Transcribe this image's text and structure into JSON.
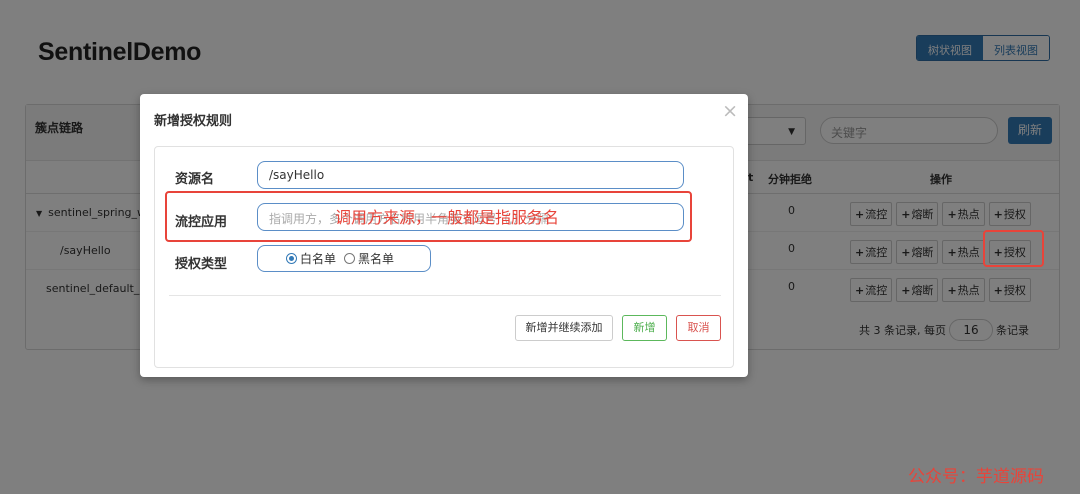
{
  "app": {
    "title": "SentinelDemo",
    "view_toggle": {
      "tree": "树状视图",
      "list": "列表视图"
    }
  },
  "panel": {
    "title": "簇点链路",
    "search_placeholder": "关键字",
    "refresh_label": "刷新",
    "columns": {
      "block_partial": "t",
      "minute_block": "分钟拒绝",
      "operations": "操作"
    },
    "rows": [
      {
        "name": "sentinel_spring_we",
        "expand_icon": "▼",
        "minute_block": "0"
      },
      {
        "name": "/sayHello",
        "minute_block": "0"
      },
      {
        "name": "sentinel_default_co",
        "minute_block": "0"
      }
    ],
    "op_labels": {
      "flow": "流控",
      "degrade": "熔断",
      "hotspot": "热点",
      "authority": "授权"
    },
    "pager": {
      "total_text": "共 3 条记录, 每页",
      "page_size": "16",
      "suffix": "条记录"
    }
  },
  "modal": {
    "title": "新增授权规则",
    "close_glyph": "×",
    "fields": {
      "resource": {
        "label": "资源名",
        "value": "/sayHello"
      },
      "limit_app": {
        "label": "流控应用",
        "placeholder": "指调用方，多个调用方名称用半角英文逗号（,）分隔"
      },
      "strategy": {
        "label": "授权类型",
        "options": [
          "白名单",
          "黑名单"
        ],
        "selected": "白名单"
      }
    },
    "buttons": {
      "add_continue": "新增并继续添加",
      "add": "新增",
      "cancel": "取消"
    }
  },
  "annotation": {
    "text": "调用方来源，一般都是指服务名"
  },
  "watermark": "公众号：芋道源码",
  "colors": {
    "primary": "#337ab7",
    "success": "#5cb85c",
    "danger": "#d9534f",
    "annotation_red": "#e8443a"
  }
}
